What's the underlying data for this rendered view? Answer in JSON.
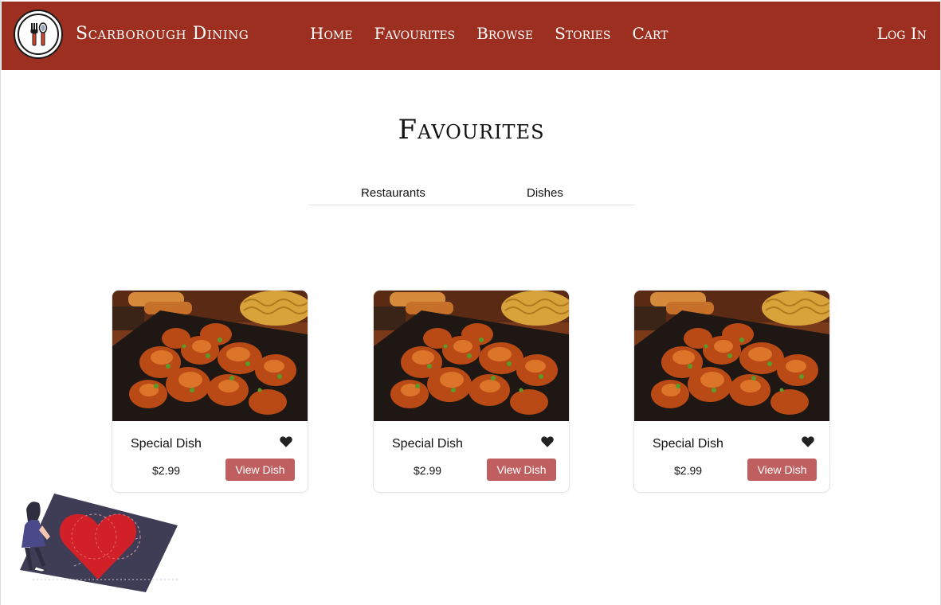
{
  "nav": {
    "brand": "Scarborough Dining",
    "links": [
      "Home",
      "Favourites",
      "Browse",
      "Stories",
      "Cart"
    ],
    "login": "Log In"
  },
  "page": {
    "title": "Favourites"
  },
  "tabs": [
    "Restaurants",
    "Dishes"
  ],
  "cards": [
    {
      "name": "Special Dish",
      "price": "$2.99",
      "button": "View Dish"
    },
    {
      "name": "Special Dish",
      "price": "$2.99",
      "button": "View Dish"
    },
    {
      "name": "Special Dish",
      "price": "$2.99",
      "button": "View Dish"
    }
  ],
  "colors": {
    "nav_bg": "#9c2f20",
    "button_bg": "#c05f60",
    "heart": "#222222",
    "illustration_heart": "#d12027"
  },
  "icons": [
    "fork-spoon-logo-icon",
    "heart-icon"
  ]
}
